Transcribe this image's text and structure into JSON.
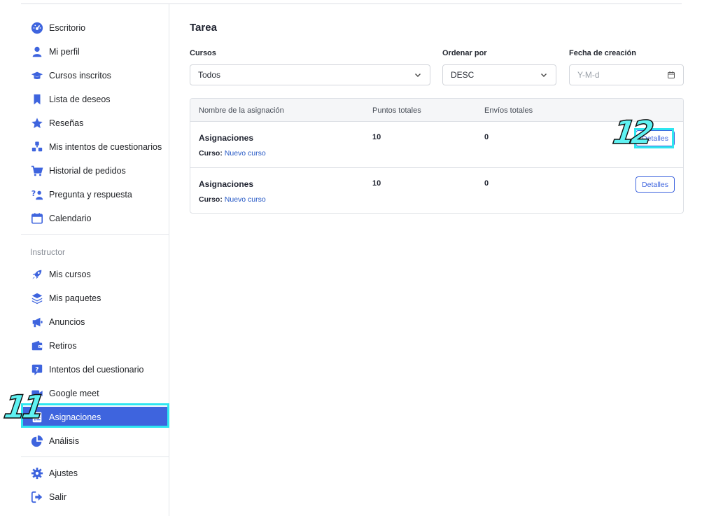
{
  "sidebar": {
    "items": [
      {
        "label": "Escritorio",
        "icon": "dashboard-icon"
      },
      {
        "label": "Mi perfil",
        "icon": "user-icon"
      },
      {
        "label": "Cursos inscritos",
        "icon": "graduation-cap-icon"
      },
      {
        "label": "Lista de deseos",
        "icon": "bookmark-icon"
      },
      {
        "label": "Reseñas",
        "icon": "star-icon"
      },
      {
        "label": "Mis intentos de cuestionarios",
        "icon": "quiz-attempts-icon"
      },
      {
        "label": "Historial de pedidos",
        "icon": "cart-icon"
      },
      {
        "label": "Pregunta y respuesta",
        "icon": "question-answer-icon"
      },
      {
        "label": "Calendario",
        "icon": "calendar-icon"
      }
    ],
    "section_label": "Instructor",
    "instructor_items": [
      {
        "label": "Mis cursos",
        "icon": "rocket-icon"
      },
      {
        "label": "Mis paquetes",
        "icon": "layers-icon"
      },
      {
        "label": "Anuncios",
        "icon": "megaphone-icon"
      },
      {
        "label": "Retiros",
        "icon": "wallet-icon"
      },
      {
        "label": "Intentos del cuestionario",
        "icon": "quiz-question-icon"
      },
      {
        "label": "Google meet",
        "icon": "video-icon"
      },
      {
        "label": "Asignaciones",
        "icon": "assignment-icon",
        "active": true
      },
      {
        "label": "Análisis",
        "icon": "pie-chart-icon"
      }
    ],
    "bottom_items": [
      {
        "label": "Ajustes",
        "icon": "gear-icon"
      },
      {
        "label": "Salir",
        "icon": "logout-icon"
      }
    ]
  },
  "annotations": {
    "left_number": "11",
    "right_number": "12",
    "color": "#2ee6f0"
  },
  "main": {
    "title": "Tarea",
    "filters": {
      "courses": {
        "label": "Cursos",
        "value": "Todos"
      },
      "order": {
        "label": "Ordenar por",
        "value": "DESC"
      },
      "date": {
        "label": "Fecha de creación",
        "placeholder": "Y-M-d"
      }
    },
    "table": {
      "headers": [
        "Nombre de la asignación",
        "Puntos totales",
        "Envíos totales"
      ],
      "rows": [
        {
          "name": "Asignaciones",
          "course_label": "Curso:",
          "course": "Nuevo curso",
          "points": "10",
          "submissions": "0",
          "action": "Detalles"
        },
        {
          "name": "Asignaciones",
          "course_label": "Curso:",
          "course": "Nuevo curso",
          "points": "10",
          "submissions": "0",
          "action": "Detalles"
        }
      ]
    }
  },
  "colors": {
    "accent": "#3e64de",
    "link": "#2457c5"
  }
}
